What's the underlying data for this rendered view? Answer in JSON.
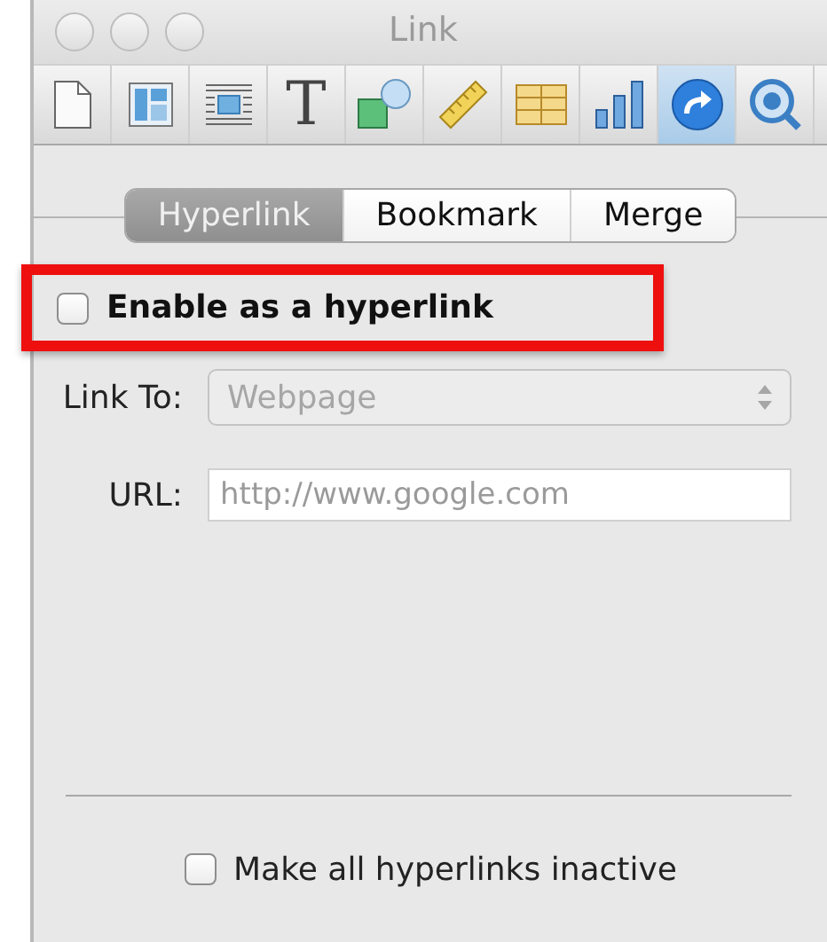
{
  "window": {
    "title": "Link"
  },
  "toolbar": [
    {
      "kind": "document",
      "selected": false
    },
    {
      "kind": "layout",
      "selected": false
    },
    {
      "kind": "wrap",
      "selected": false
    },
    {
      "kind": "glyph",
      "label": "T",
      "selected": false
    },
    {
      "kind": "shapes",
      "selected": false
    },
    {
      "kind": "ruler",
      "selected": false
    },
    {
      "kind": "table",
      "selected": false
    },
    {
      "kind": "chart",
      "selected": false
    },
    {
      "kind": "link",
      "selected": true
    },
    {
      "kind": "media",
      "selected": false
    }
  ],
  "tabs": [
    {
      "label": "Hyperlink",
      "selected": true
    },
    {
      "label": "Bookmark",
      "selected": false
    },
    {
      "label": "Merge",
      "selected": false
    }
  ],
  "enable": {
    "label": "Enable as a hyperlink",
    "checked": false,
    "highlighted": true
  },
  "link_to": {
    "label": "Link To:",
    "value": "Webpage",
    "disabled": true
  },
  "url": {
    "label": "URL:",
    "placeholder": "http://www.google.com"
  },
  "inactive": {
    "label": "Make all hyperlinks inactive",
    "checked": false
  }
}
